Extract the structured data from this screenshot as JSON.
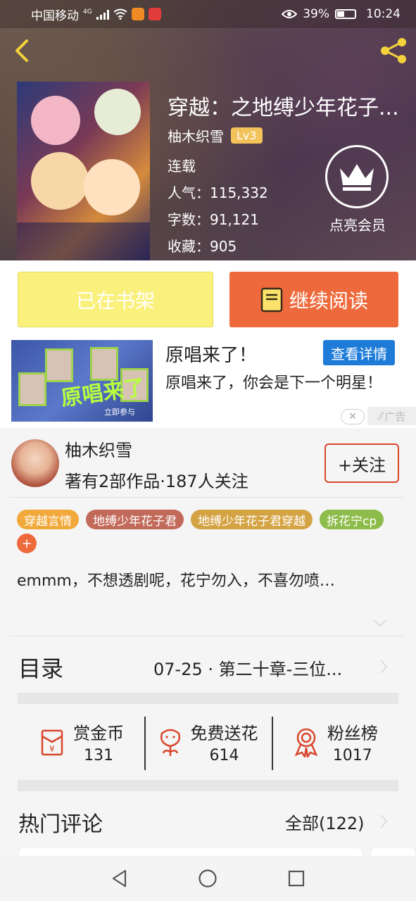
{
  "status_bar": {
    "carrier": "中国移动",
    "network": "4G",
    "battery": "39%",
    "time": "10:24"
  },
  "book": {
    "title": "穿越：之地缚少年花子...",
    "author": "柚木织雪",
    "level": "Lv3",
    "state": "连载",
    "popularity": "人气：115,332",
    "words": "字数：91,121",
    "favorites": "收藏：905",
    "vip_label": "点亮会员"
  },
  "actions": {
    "shelf_label": "已在书架",
    "read_label": "继续阅读"
  },
  "ad": {
    "title": "原唱来了！",
    "button": "查看详情",
    "description": "原唱来了，你会是下一个明星！",
    "badge": "广告",
    "image_text": "原唱来了",
    "image_sub": "立即参与"
  },
  "author_card": {
    "name": "柚木织雪",
    "subtitle": "著有2部作品·187人关注",
    "follow_label": "+关注"
  },
  "tags": [
    {
      "label": "穿越言情",
      "color": "#f0a93a"
    },
    {
      "label": "地缚少年花子君",
      "color": "#c26a5a"
    },
    {
      "label": "地缚少年花子君穿越",
      "color": "#d4a343"
    },
    {
      "label": "拆花宁cp",
      "color": "#8ebc4a"
    }
  ],
  "tag_more": "+",
  "intro": "emmm，不想透剧呢，花宁勿入，不喜勿喷…",
  "toc": {
    "label": "目录",
    "latest": "07-25 · 第二十章-三位..."
  },
  "stats": [
    {
      "label": "赏金币",
      "value": "131",
      "icon": "coin-envelope-icon"
    },
    {
      "label": "免费送花",
      "value": "614",
      "icon": "flower-icon"
    },
    {
      "label": "粉丝榜",
      "value": "1017",
      "icon": "medal-icon"
    }
  ],
  "comments": {
    "title": "热门评论",
    "all_label": "全部(122)"
  },
  "colors": {
    "accent": "#ee6a3c",
    "shelf_button": "#faf07c",
    "ad_button": "#1e7bd8",
    "level_badge": "#f3c25a"
  }
}
